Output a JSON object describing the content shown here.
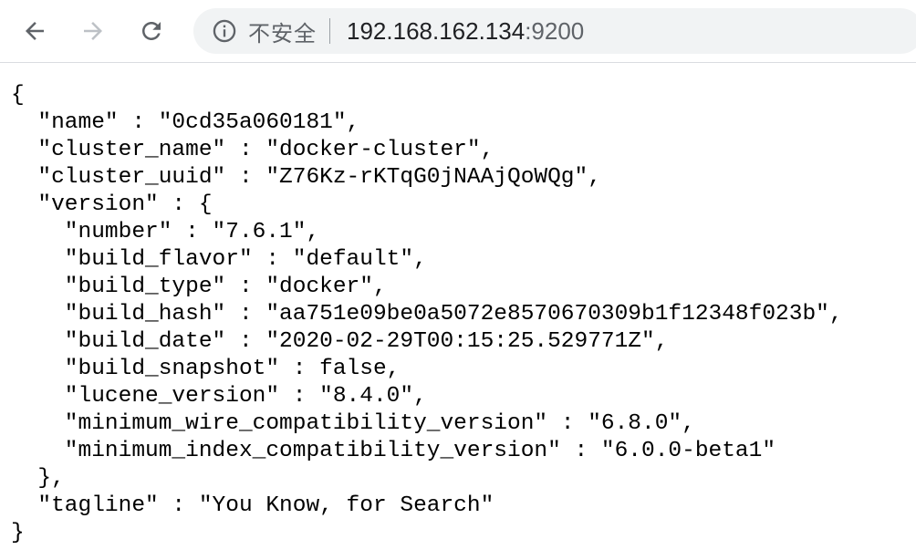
{
  "browser": {
    "back_icon": "arrow-left-icon",
    "forward_icon": "arrow-right-icon",
    "reload_icon": "reload-icon",
    "info_icon": "info-circle-icon",
    "security_label": "不安全",
    "url_host": "192.168.162.134",
    "url_port": ":9200"
  },
  "response": {
    "lines": [
      "{",
      "  \"name\" : \"0cd35a060181\",",
      "  \"cluster_name\" : \"docker-cluster\",",
      "  \"cluster_uuid\" : \"Z76Kz-rKTqG0jNAAjQoWQg\",",
      "  \"version\" : {",
      "    \"number\" : \"7.6.1\",",
      "    \"build_flavor\" : \"default\",",
      "    \"build_type\" : \"docker\",",
      "    \"build_hash\" : \"aa751e09be0a5072e8570670309b1f12348f023b\",",
      "    \"build_date\" : \"2020-02-29T00:15:25.529771Z\",",
      "    \"build_snapshot\" : false,",
      "    \"lucene_version\" : \"8.4.0\",",
      "    \"minimum_wire_compatibility_version\" : \"6.8.0\",",
      "    \"minimum_index_compatibility_version\" : \"6.0.0-beta1\"",
      "  },",
      "  \"tagline\" : \"You Know, for Search\"",
      "}"
    ]
  }
}
